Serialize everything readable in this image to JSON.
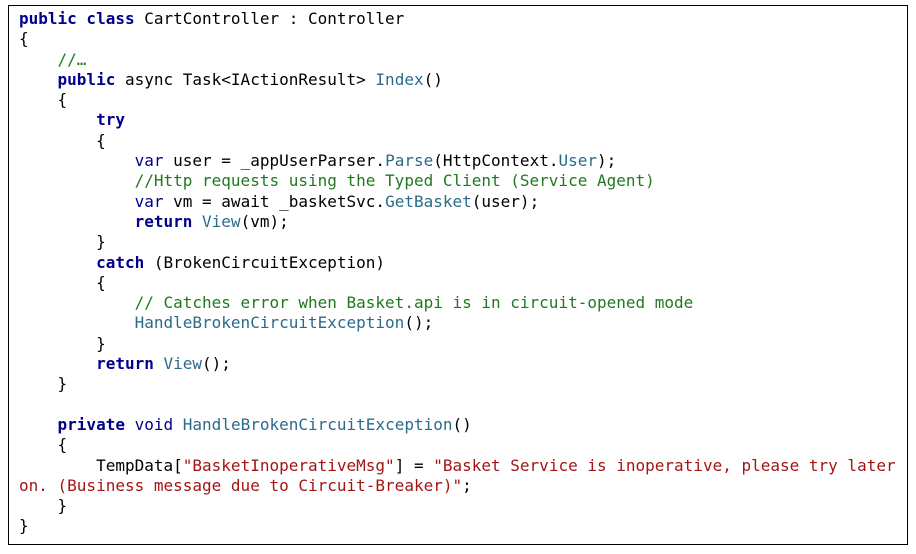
{
  "colors": {
    "keyword": "#00008b",
    "type": "#2b6b8a",
    "comment": "#1f7a1f",
    "string": "#a31515",
    "text": "#000000",
    "border": "#000000",
    "background": "#ffffff"
  },
  "lines": [
    [
      {
        "t": "kw",
        "v": "public class"
      },
      {
        "t": "plain",
        "v": " CartController : Controller"
      }
    ],
    [
      {
        "t": "plain",
        "v": "{"
      }
    ],
    [
      {
        "t": "plain",
        "v": "    "
      },
      {
        "t": "cm",
        "v": "//…"
      }
    ],
    [
      {
        "t": "plain",
        "v": "    "
      },
      {
        "t": "kw",
        "v": "public"
      },
      {
        "t": "plain",
        "v": " async Task<IActionResult> "
      },
      {
        "t": "type",
        "v": "Index"
      },
      {
        "t": "plain",
        "v": "()"
      }
    ],
    [
      {
        "t": "plain",
        "v": "    {"
      }
    ],
    [
      {
        "t": "plain",
        "v": "        "
      },
      {
        "t": "kw",
        "v": "try"
      }
    ],
    [
      {
        "t": "plain",
        "v": "        {"
      }
    ],
    [
      {
        "t": "plain",
        "v": "            "
      },
      {
        "t": "kw2",
        "v": "var"
      },
      {
        "t": "plain",
        "v": " user = _appUserParser."
      },
      {
        "t": "type",
        "v": "Parse"
      },
      {
        "t": "plain",
        "v": "(HttpContext."
      },
      {
        "t": "type",
        "v": "User"
      },
      {
        "t": "plain",
        "v": ");"
      }
    ],
    [
      {
        "t": "plain",
        "v": "            "
      },
      {
        "t": "cm",
        "v": "//Http requests using the Typed Client (Service Agent)"
      }
    ],
    [
      {
        "t": "plain",
        "v": "            "
      },
      {
        "t": "kw2",
        "v": "var"
      },
      {
        "t": "plain",
        "v": " vm = await _basketSvc."
      },
      {
        "t": "type",
        "v": "GetBasket"
      },
      {
        "t": "plain",
        "v": "(user);"
      }
    ],
    [
      {
        "t": "plain",
        "v": "            "
      },
      {
        "t": "kw",
        "v": "return"
      },
      {
        "t": "plain",
        "v": " "
      },
      {
        "t": "type",
        "v": "View"
      },
      {
        "t": "plain",
        "v": "(vm);"
      }
    ],
    [
      {
        "t": "plain",
        "v": "        }"
      }
    ],
    [
      {
        "t": "plain",
        "v": "        "
      },
      {
        "t": "kw",
        "v": "catch"
      },
      {
        "t": "plain",
        "v": " (BrokenCircuitException)"
      }
    ],
    [
      {
        "t": "plain",
        "v": "        {"
      }
    ],
    [
      {
        "t": "plain",
        "v": "            "
      },
      {
        "t": "cm",
        "v": "// Catches error when Basket.api is in circuit-opened mode"
      }
    ],
    [
      {
        "t": "plain",
        "v": "            "
      },
      {
        "t": "type",
        "v": "HandleBrokenCircuitException"
      },
      {
        "t": "plain",
        "v": "();"
      }
    ],
    [
      {
        "t": "plain",
        "v": "        }"
      }
    ],
    [
      {
        "t": "plain",
        "v": "        "
      },
      {
        "t": "kw",
        "v": "return"
      },
      {
        "t": "plain",
        "v": " "
      },
      {
        "t": "type",
        "v": "View"
      },
      {
        "t": "plain",
        "v": "();"
      }
    ],
    [
      {
        "t": "plain",
        "v": "    }"
      }
    ],
    [
      {
        "t": "plain",
        "v": ""
      }
    ],
    [
      {
        "t": "plain",
        "v": "    "
      },
      {
        "t": "kw",
        "v": "private"
      },
      {
        "t": "plain",
        "v": " "
      },
      {
        "t": "kw2",
        "v": "void"
      },
      {
        "t": "plain",
        "v": " "
      },
      {
        "t": "type",
        "v": "HandleBrokenCircuitException"
      },
      {
        "t": "plain",
        "v": "()"
      }
    ],
    [
      {
        "t": "plain",
        "v": "    {"
      }
    ],
    [
      {
        "t": "plain",
        "v": "        TempData["
      },
      {
        "t": "str",
        "v": "\"BasketInoperativeMsg\""
      },
      {
        "t": "plain",
        "v": "] = "
      },
      {
        "t": "str",
        "v": "\"Basket Service is inoperative, please try later"
      }
    ],
    [
      {
        "t": "str",
        "v": "on. (Business message due to Circuit-Breaker)\""
      },
      {
        "t": "plain",
        "v": ";"
      }
    ],
    [
      {
        "t": "plain",
        "v": "    }"
      }
    ],
    [
      {
        "t": "plain",
        "v": "}"
      }
    ]
  ]
}
